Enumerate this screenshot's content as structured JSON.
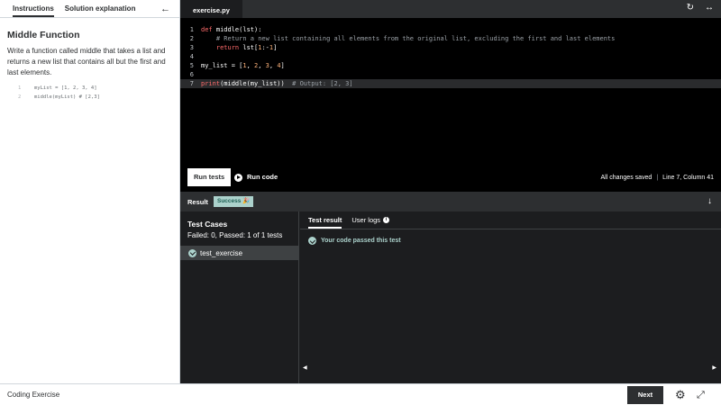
{
  "left_panel": {
    "tabs": [
      {
        "label": "Instructions",
        "active": true
      },
      {
        "label": "Solution explanation",
        "active": false
      }
    ],
    "title": "Middle Function",
    "description": "Write a function called middle that takes a list and returns a new list that contains all but the first and last elements.",
    "example": [
      {
        "num": "1",
        "code": "myList = [1, 2, 3, 4]"
      },
      {
        "num": "2",
        "code": "middle(myList)  # [2,3]"
      }
    ]
  },
  "editor": {
    "file_tab": "exercise.py",
    "lines": [
      {
        "num": "1",
        "segments": [
          {
            "t": "def ",
            "c": "kw"
          },
          {
            "t": "middle(lst):",
            "c": "sl"
          }
        ]
      },
      {
        "num": "2",
        "segments": [
          {
            "t": "    # Return a new list containing all elements from the original list, excluding the first and last elements",
            "c": "cm"
          }
        ]
      },
      {
        "num": "3",
        "segments": [
          {
            "t": "    ",
            "c": "sl"
          },
          {
            "t": "return ",
            "c": "kw"
          },
          {
            "t": "lst[",
            "c": "sl"
          },
          {
            "t": "1",
            "c": "num"
          },
          {
            "t": ":-",
            "c": "sl"
          },
          {
            "t": "1",
            "c": "num"
          },
          {
            "t": "]",
            "c": "sl"
          }
        ]
      },
      {
        "num": "4",
        "segments": []
      },
      {
        "num": "5",
        "segments": [
          {
            "t": "my_list = [",
            "c": "sl"
          },
          {
            "t": "1",
            "c": "num"
          },
          {
            "t": ", ",
            "c": "sl"
          },
          {
            "t": "2",
            "c": "num"
          },
          {
            "t": ", ",
            "c": "sl"
          },
          {
            "t": "3",
            "c": "num"
          },
          {
            "t": ", ",
            "c": "sl"
          },
          {
            "t": "4",
            "c": "num"
          },
          {
            "t": "]",
            "c": "sl"
          }
        ]
      },
      {
        "num": "6",
        "segments": []
      },
      {
        "num": "7",
        "active": true,
        "segments": [
          {
            "t": "print",
            "c": "kw"
          },
          {
            "t": "(middle(my_list))  ",
            "c": "sl"
          },
          {
            "t": "# Output: [2, 3]",
            "c": "cm"
          }
        ]
      }
    ],
    "run_tests_label": "Run tests",
    "run_code_label": "Run code",
    "save_status": "All changes saved",
    "separator": "|",
    "cursor_position": "Line 7, Column 41"
  },
  "result": {
    "label": "Result",
    "badge": "Success",
    "badge_emoji": "🎉",
    "test_cases_title": "Test Cases",
    "summary": "Failed: 0, Passed: 1 of 1 tests",
    "test_items": [
      {
        "name": "test_exercise",
        "status": "passed"
      }
    ],
    "tabs": [
      {
        "label": "Test result",
        "active": true
      },
      {
        "label": "User logs",
        "active": false
      }
    ],
    "pass_message": "Your code passed this test"
  },
  "footer": {
    "title": "Coding Exercise",
    "next_label": "Next"
  },
  "icons": {
    "back": "arrow-left-icon",
    "reset": "reset-icon",
    "expand": "expand-horizontal-icon",
    "collapse_result": "arrow-down-icon",
    "settings": "gear-icon",
    "minimize": "collapse-icon"
  },
  "colors": {
    "success": "#acd2cc",
    "keyword": "#ff6b6b",
    "number": "#ffb37a",
    "comment": "#9aa0a6",
    "dark_bg": "#1c1d1f"
  }
}
